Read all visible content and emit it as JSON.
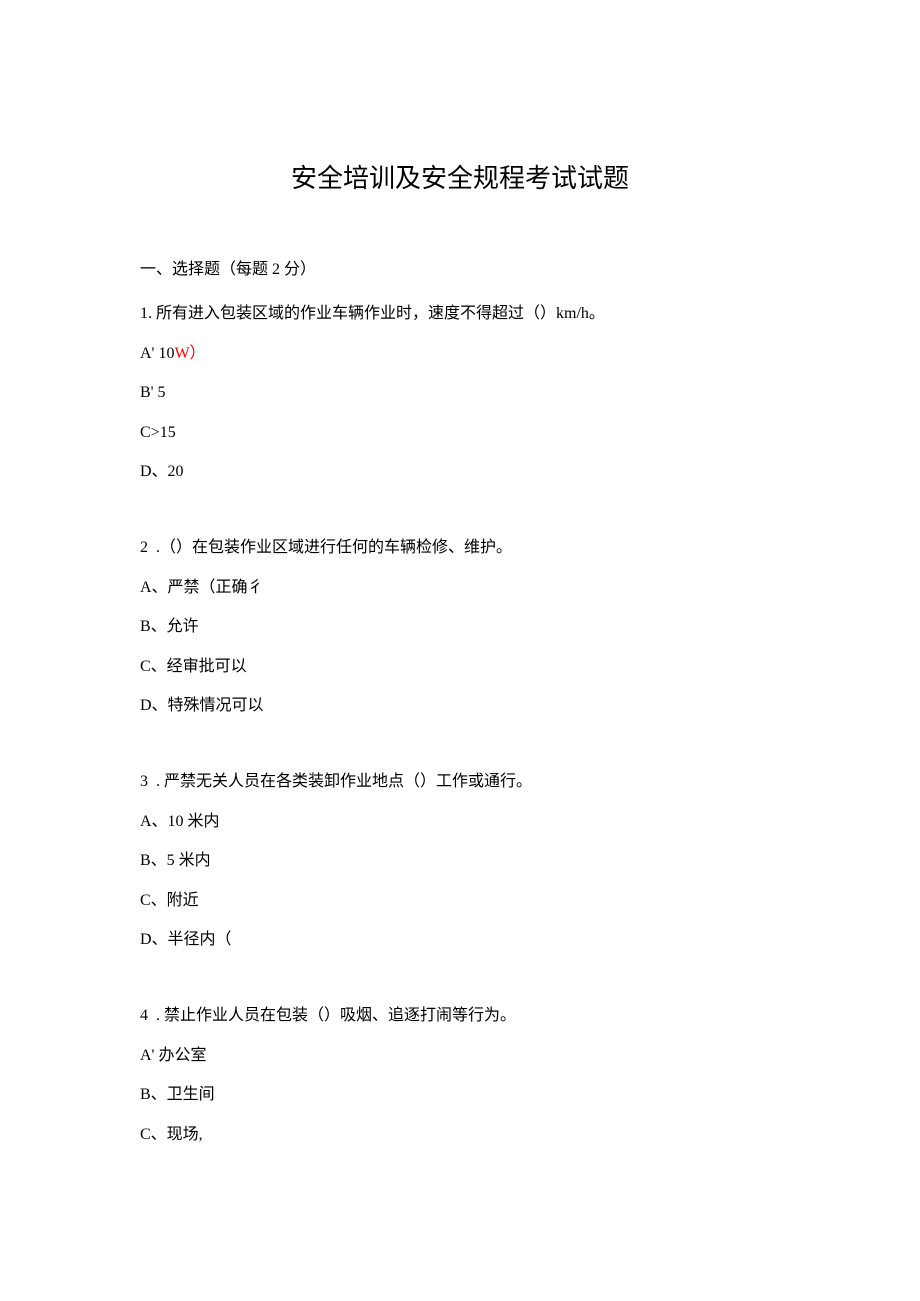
{
  "title": "安全培训及安全规程考试试题",
  "section_header": "一、选择题（每题 2 分）",
  "questions": [
    {
      "text": "1. 所有进入包装区域的作业车辆作业时，速度不得超过（）km/h。",
      "options": [
        {
          "prefix": "A' 10",
          "suffix": "W）",
          "mark": true
        },
        {
          "prefix": "B' 5",
          "suffix": ""
        },
        {
          "prefix": "C>15",
          "suffix": ""
        },
        {
          "prefix": "D、20",
          "suffix": ""
        }
      ]
    },
    {
      "text": "2  .（）在包装作业区域进行任何的车辆检修、维护。",
      "options": [
        {
          "prefix": "A、严禁（正确彳",
          "suffix": ""
        },
        {
          "prefix": "B、允许",
          "suffix": ""
        },
        {
          "prefix": "C、经审批可以",
          "suffix": ""
        },
        {
          "prefix": "D、特殊情况可以",
          "suffix": ""
        }
      ]
    },
    {
      "text": "3  . 严禁无关人员在各类装卸作业地点（）工作或通行。",
      "options": [
        {
          "prefix": "A、10 米内",
          "suffix": ""
        },
        {
          "prefix": "B、5 米内",
          "suffix": ""
        },
        {
          "prefix": "C、附近",
          "suffix": ""
        },
        {
          "prefix": "D、半径内（",
          "suffix": ""
        }
      ]
    },
    {
      "text": "4  . 禁止作业人员在包装（）吸烟、追逐打闹等行为。",
      "options": [
        {
          "prefix": "A' 办公室",
          "suffix": ""
        },
        {
          "prefix": "B、卫生间",
          "suffix": ""
        },
        {
          "prefix": "C、现场,",
          "suffix": ""
        }
      ]
    }
  ]
}
